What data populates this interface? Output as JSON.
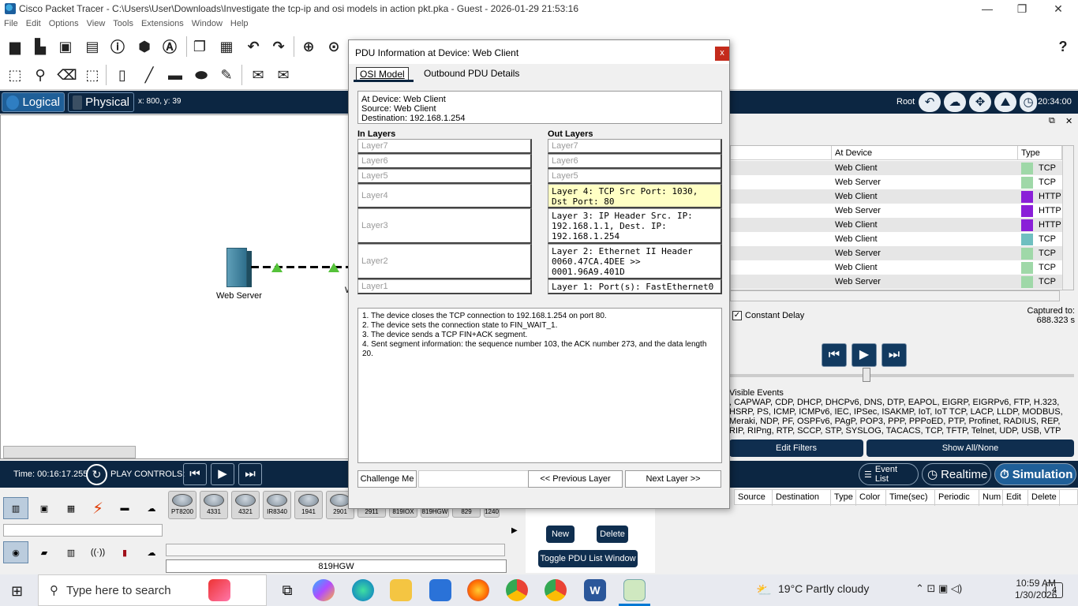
{
  "window": {
    "title": "Cisco Packet Tracer - C:\\Users\\User\\Downloads\\Investigate the tcp-ip and osi models in action pkt.pka - Guest - 2026-01-29 21:53:16",
    "minimize": "—",
    "restore": "❐",
    "close": "✕"
  },
  "menu": [
    "File",
    "Edit",
    "Options",
    "View",
    "Tools",
    "Extensions",
    "Window",
    "Help"
  ],
  "help_icon": "?",
  "workspace": {
    "logical_label": "Logical",
    "physical_label": "Physical",
    "coords": "x: 800, y: 39",
    "root_label": "Root",
    "clock": "20:34:00",
    "server_label": "Web Server",
    "partial_label": "W"
  },
  "event_list": {
    "headers": {
      "at_device": "At Device",
      "type": "Type"
    },
    "rows": [
      {
        "device": "Web Client",
        "type": "TCP",
        "color": "#9fd8a8"
      },
      {
        "device": "Web Server",
        "type": "TCP",
        "color": "#9fd8a8"
      },
      {
        "device": "Web Client",
        "type": "HTTP",
        "color": "#8a1fd8"
      },
      {
        "device": "Web Server",
        "type": "HTTP",
        "color": "#8a1fd8"
      },
      {
        "device": "Web Client",
        "type": "HTTP",
        "color": "#8a1fd8"
      },
      {
        "device": "Web Client",
        "type": "TCP",
        "color": "#6fbfc0"
      },
      {
        "device": "Web Server",
        "type": "TCP",
        "color": "#9fd8a8"
      },
      {
        "device": "Web Client",
        "type": "TCP",
        "color": "#9fd8a8"
      },
      {
        "device": "Web Server",
        "type": "TCP",
        "color": "#9fd8a8"
      }
    ],
    "constant_delay": "Constant Delay",
    "captured_to": "Captured to:",
    "captured_value": "688.323 s",
    "visible_events_title": "Visible Events",
    "visible_events_text": ", CAPWAP, CDP, DHCP, DHCPv6, DNS, DTP, EAPOL, EIGRP, EIGRPv6, FTP, H.323, HSRP, PS, ICMP, ICMPv6, IEC, IPSec, ISAKMP, IoT, IoT TCP, LACP, LLDP, MODBUS, Meraki, NDP, PF, OSPFv6, PAgP, POP3, PPP, PPPoED, PTP, Profinet, RADIUS, REP, RIP, RIPng, RTP, SCCP, STP, SYSLOG, TACACS, TCP, TFTP, Telnet, UDP, USB, VTP",
    "edit_filters": "Edit Filters",
    "show_all_none": "Show All/None"
  },
  "bottom": {
    "time": "Time: 00:16:17.255",
    "play_controls": "PLAY CONTROLS:",
    "event_list_tab": "Event List",
    "realtime_tab": "Realtime",
    "simulation_tab": "Simulation"
  },
  "palette": {
    "devices": [
      "PT8200",
      "4331",
      "4321",
      "IR8340",
      "1941",
      "2901",
      "2911",
      "819IOX",
      "819HGW",
      "829",
      "1240"
    ],
    "selected_label": "819HGW"
  },
  "pdu_list": {
    "headers": [
      "Source",
      "Destination",
      "Type",
      "Color",
      "Time(sec)",
      "Periodic",
      "Num",
      "Edit",
      "Delete"
    ],
    "new_btn": "New",
    "delete_btn": "Delete",
    "toggle_btn": "Toggle PDU List Window"
  },
  "dialog": {
    "title": "PDU Information at Device: Web Client",
    "close": "x",
    "tab_osi": "OSI Model",
    "tab_outbound": "Outbound PDU Details",
    "at_device": "At Device: Web Client",
    "source": "Source: Web Client",
    "destination": "Destination: 192.168.1.254",
    "in_layers_title": "In Layers",
    "out_layers_title": "Out Layers",
    "in_layers": [
      "Layer7",
      "Layer6",
      "Layer5",
      "Layer4",
      "Layer3",
      "Layer2",
      "Layer1"
    ],
    "out_layers": [
      "Layer7",
      "Layer6",
      "Layer5",
      "Layer 4: TCP Src Port: 1030, Dst Port: 80",
      "Layer 3: IP Header Src. IP: 192.168.1.1, Dest. IP: 192.168.1.254",
      "Layer 2: Ethernet II Header 0060.47CA.4DEE >> 0001.96A9.401D",
      "Layer 1: Port(s): FastEthernet0"
    ],
    "description": [
      "1. The device closes the TCP connection to 192.168.1.254 on port 80.",
      "2. The device sets the connection state to FIN_WAIT_1.",
      "3. The device sends a TCP FIN+ACK segment.",
      "4. Sent segment information: the sequence number 103, the ACK number 273, and the data length 20."
    ],
    "challenge_btn": "Challenge Me",
    "prev_btn": "<< Previous Layer",
    "next_btn": "Next Layer >>"
  },
  "taskbar": {
    "search_placeholder": "Type here to search",
    "weather": "19°C  Partly cloudy",
    "time": "10:59 AM",
    "date": "1/30/2026",
    "notif_count": "4"
  }
}
